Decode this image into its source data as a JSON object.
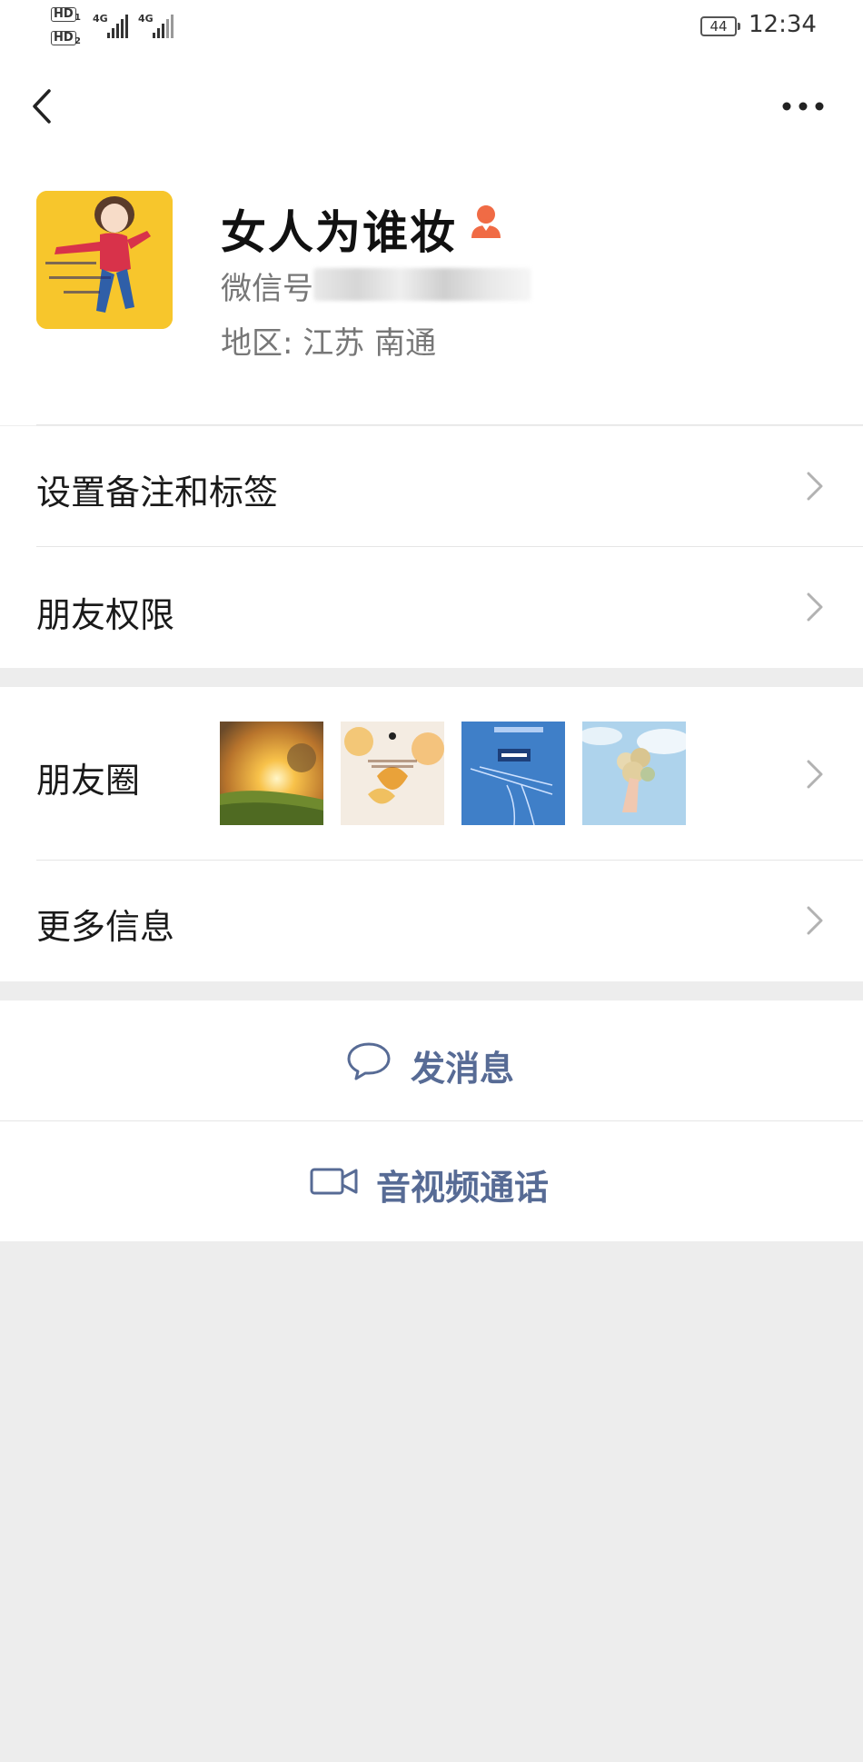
{
  "status_bar": {
    "sim1_badge": "HD",
    "sim1_slot": "1",
    "sim2_badge": "HD",
    "sim2_slot": "2",
    "network1": "4G",
    "network2": "4G",
    "battery_level": "44",
    "time": "12:34"
  },
  "nav": {
    "back_icon": "chevron-left-icon",
    "more_icon": "more-dots-icon"
  },
  "profile": {
    "nickname": "女人为谁妆",
    "gender_icon": "female-icon",
    "gender_color": "#f06b45",
    "wechat_id_label": "微信号",
    "region": "地区:  江苏  南通"
  },
  "rows": {
    "remark_tags": "设置备注和标签",
    "friend_permissions": "朋友权限",
    "moments": "朋友圈",
    "more_info": "更多信息"
  },
  "actions": {
    "send_message": "发消息",
    "av_call": "音视频通话",
    "link_color": "#576b95"
  }
}
